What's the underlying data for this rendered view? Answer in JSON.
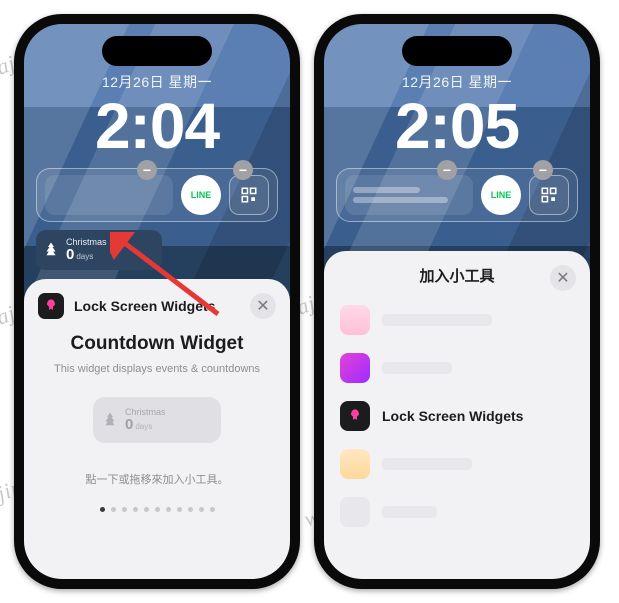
{
  "watermark_text": "w.wajinchan.com",
  "left": {
    "date": "12月26日 星期一",
    "time": "2:04",
    "minus": "−",
    "line_label": "LINE",
    "countdown": {
      "event": "Christmas",
      "value": "0",
      "unit": "days"
    },
    "sheet": {
      "app_name": "Lock Screen Widgets",
      "title": "Countdown Widget",
      "subtitle": "This widget displays events & countdowns",
      "preview": {
        "event": "Christmas",
        "value": "0",
        "unit": "days"
      },
      "hint": "點一下或拖移來加入小工具。",
      "close": "✕"
    }
  },
  "right": {
    "date": "12月26日 星期一",
    "time": "2:05",
    "minus": "−",
    "line_label": "LINE",
    "sheet": {
      "title": "加入小工具",
      "close": "✕",
      "featured_label": "Lock Screen Widgets"
    }
  }
}
